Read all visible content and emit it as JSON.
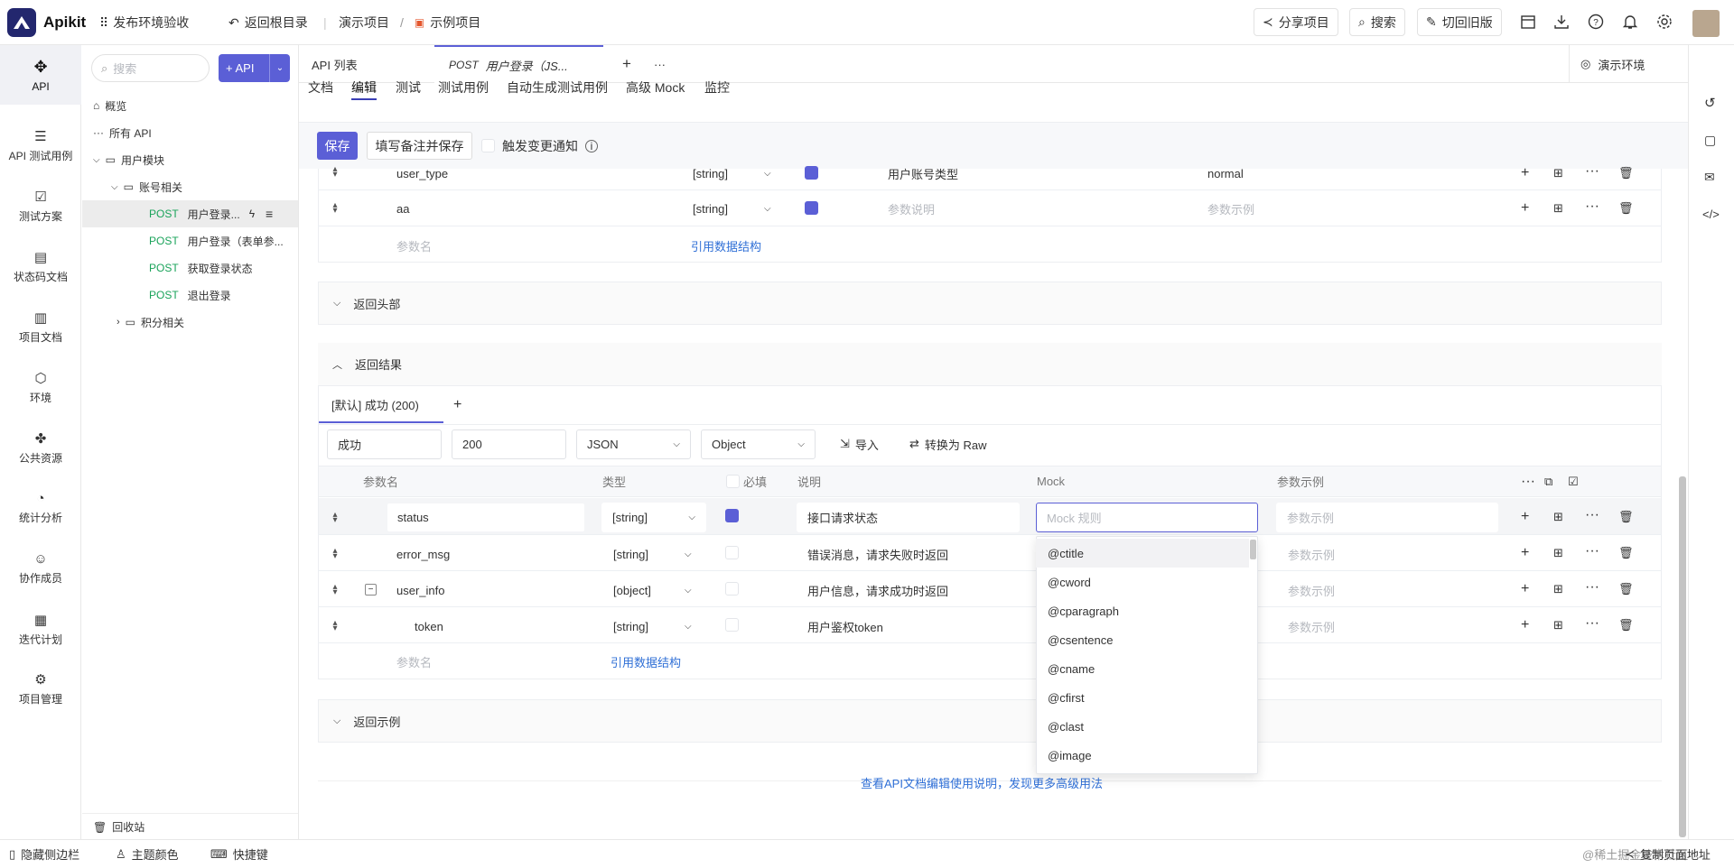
{
  "topbar": {
    "brand": "Apikit",
    "env_check": "发布环境验收",
    "back_root": "返回根目录",
    "crumb_1": "演示项目",
    "crumb_sep": "/",
    "crumb_2": "示例项目",
    "share": "分享项目",
    "search": "搜索",
    "switch_old": "切回旧版"
  },
  "rail": [
    "API",
    "API 测试用例",
    "测试方案",
    "状态码文档",
    "项目文档",
    "环境",
    "公共资源",
    "统计分析",
    "协作成员",
    "迭代计划",
    "项目管理"
  ],
  "tree": {
    "search_placeholder": "搜索",
    "add_api": "+ API",
    "overview": "概览",
    "all_api": "所有 API",
    "user_module": "用户模块",
    "account_group": "账号相关",
    "apis": [
      {
        "method": "POST",
        "name": "用户登录..."
      },
      {
        "method": "POST",
        "name": "用户登录（表单参..."
      },
      {
        "method": "POST",
        "name": "获取登录状态"
      },
      {
        "method": "POST",
        "name": "退出登录"
      }
    ],
    "points_group": "积分相关",
    "recycle": "回收站"
  },
  "tabs": {
    "api_list": "API 列表",
    "active_method": "POST",
    "active_name": "用户登录（JS...",
    "plus": "+",
    "more": "···",
    "env": "演示环境"
  },
  "subtabs": [
    "文档",
    "编辑",
    "测试",
    "测试用例",
    "自动生成测试用例",
    "高级 Mock",
    "监控"
  ],
  "toolbar": {
    "save": "保存",
    "save_note": "填写备注并保存",
    "notify": "触发变更通知"
  },
  "req_rows": [
    {
      "name": "user_type",
      "type": "[string]",
      "desc": "用户账号类型",
      "example": "normal",
      "required": true
    },
    {
      "name": "aa",
      "type": "[string]",
      "desc": "参数说明",
      "example": "参数示例",
      "required": true
    }
  ],
  "req_add": {
    "name_ph": "参数名",
    "ref": "引用数据结构"
  },
  "sections": {
    "headers": "返回头部",
    "results": "返回结果",
    "examples": "返回示例"
  },
  "resp": {
    "tab": "[默认] 成功 (200)",
    "plus": "+",
    "name_val": "成功",
    "code_val": "200",
    "format": "JSON",
    "root": "Object",
    "import": "导入",
    "raw": "转换为 Raw"
  },
  "cols": {
    "name": "参数名",
    "type": "类型",
    "required": "必填",
    "desc": "说明",
    "mock": "Mock",
    "example": "参数示例"
  },
  "resp_rows": [
    {
      "name": "status",
      "type": "[string]",
      "desc": "接口请求状态",
      "required": true,
      "example": "参数示例"
    },
    {
      "name": "error_msg",
      "type": "[string]",
      "desc": "错误消息，请求失败时返回",
      "required": false,
      "example": "参数示例"
    },
    {
      "name": "user_info",
      "type": "[object]",
      "desc": "用户信息，请求成功时返回",
      "required": false,
      "example": "参数示例"
    },
    {
      "name": "token",
      "type": "[string]",
      "desc": "用户鉴权token",
      "required": false,
      "example": "参数示例"
    }
  ],
  "mock": {
    "placeholder": "Mock 规则",
    "options": [
      "@ctitle",
      "@cword",
      "@cparagraph",
      "@csentence",
      "@cname",
      "@cfirst",
      "@clast",
      "@image"
    ]
  },
  "resp_add": {
    "name_ph": "参数名",
    "ref": "引用数据结构"
  },
  "help_link": "查看API文档编辑使用说明，发现更多高级用法",
  "bottom": {
    "hide_sidebar": "隐藏侧边栏",
    "theme": "主题颜色",
    "shortcuts": "快捷键",
    "copy_url": "复制页面地址",
    "watermark": "@稀土掘金技术社区"
  },
  "colors": {
    "accent": "#5b5fd6",
    "green": "#1aa35a",
    "link": "#2f6fd6"
  }
}
